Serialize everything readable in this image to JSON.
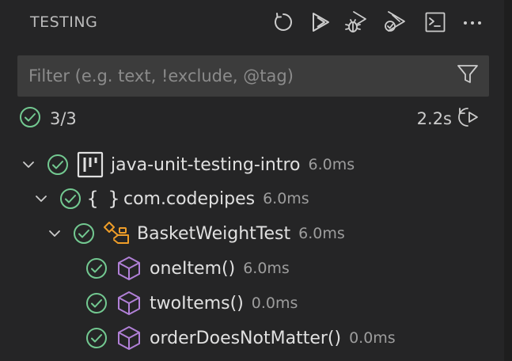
{
  "header": {
    "title": "TESTING",
    "toolbar": [
      {
        "name": "refresh-tests-button",
        "icon": "refresh-icon"
      },
      {
        "name": "run-tests-button",
        "icon": "run-icon"
      },
      {
        "name": "debug-tests-button",
        "icon": "debug-icon"
      },
      {
        "name": "run-with-coverage-button",
        "icon": "run-all-icon"
      },
      {
        "name": "show-output-button",
        "icon": "terminal-icon"
      },
      {
        "name": "more-actions-button",
        "icon": "ellipsis-icon"
      }
    ]
  },
  "filter": {
    "placeholder": "Filter (e.g. text, !exclude, @tag)",
    "value": "",
    "icon": "filter-icon"
  },
  "summary": {
    "count": "3/3",
    "duration": "2.2s",
    "icon": "pass-icon",
    "rerun_icon": "rerun-icon"
  },
  "tree": {
    "items": [
      {
        "label": "java-unit-testing-intro",
        "duration": "6.0ms",
        "kind": "project-icon",
        "status": "passed",
        "expanded": true
      },
      {
        "label": "com.codepipes",
        "duration": "6.0ms",
        "kind": "namespace-icon",
        "braces": "{ }",
        "status": "passed",
        "expanded": true
      },
      {
        "label": "BasketWeightTest",
        "duration": "6.0ms",
        "kind": "class-icon",
        "status": "passed",
        "expanded": true
      },
      {
        "label": "oneItem()",
        "duration": "6.0ms",
        "kind": "method-icon",
        "status": "passed"
      },
      {
        "label": "twoItems()",
        "duration": "0.0ms",
        "kind": "method-icon",
        "status": "passed"
      },
      {
        "label": "orderDoesNotMatter()",
        "duration": "0.0ms",
        "kind": "method-icon",
        "status": "passed"
      }
    ]
  },
  "colors": {
    "background": "#252526",
    "input_bg": "#3c3c3c",
    "pass_green": "#73c991",
    "class_orange": "#ee9d28",
    "method_purple": "#b180d7",
    "text": "#cccccc",
    "muted": "#9d9d9d"
  }
}
